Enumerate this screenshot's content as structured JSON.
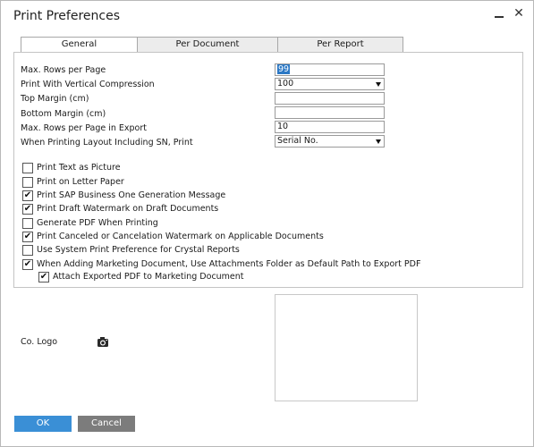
{
  "window": {
    "title": "Print Preferences",
    "minimize_label": "",
    "close_label": "✕"
  },
  "tabs": [
    {
      "label": "General",
      "active": true
    },
    {
      "label": "Per Document",
      "active": false
    },
    {
      "label": "Per Report",
      "active": false
    }
  ],
  "fields": {
    "max_rows": {
      "label": "Max. Rows per Page",
      "value": "99"
    },
    "vertical_compression": {
      "label": "Print With Vertical Compression",
      "value": "100"
    },
    "top_margin": {
      "label": "Top Margin (cm)",
      "value": ""
    },
    "bottom_margin": {
      "label": "Bottom Margin (cm)",
      "value": ""
    },
    "max_rows_export": {
      "label": "Max. Rows per Page in Export",
      "value": "10"
    },
    "sn_print": {
      "label": "When Printing Layout Including SN, Print",
      "value": "Serial No."
    }
  },
  "checkboxes": [
    {
      "label": "Print Text as Picture",
      "checked": false
    },
    {
      "label": "Print on Letter Paper",
      "checked": false
    },
    {
      "label": "Print SAP Business One Generation Message",
      "checked": true
    },
    {
      "label": "Print Draft Watermark on Draft Documents",
      "checked": true
    },
    {
      "label": "Generate PDF When Printing",
      "checked": false
    },
    {
      "label": "Print Canceled or Cancelation Watermark on Applicable Documents",
      "checked": true
    },
    {
      "label": "Use System Print Preference for Crystal Reports",
      "checked": false
    },
    {
      "label": "When Adding Marketing Document, Use Attachments Folder as Default Path to Export PDF",
      "checked": true
    },
    {
      "label": "Attach Exported PDF to Marketing Document",
      "checked": true
    }
  ],
  "logo": {
    "label": "Co. Logo",
    "icon": "camera-icon"
  },
  "buttons": {
    "ok": "OK",
    "cancel": "Cancel"
  },
  "colors": {
    "ok_button": "#3a8fd6",
    "cancel_button": "#7c7c7c",
    "selection": "#2b78c5"
  }
}
